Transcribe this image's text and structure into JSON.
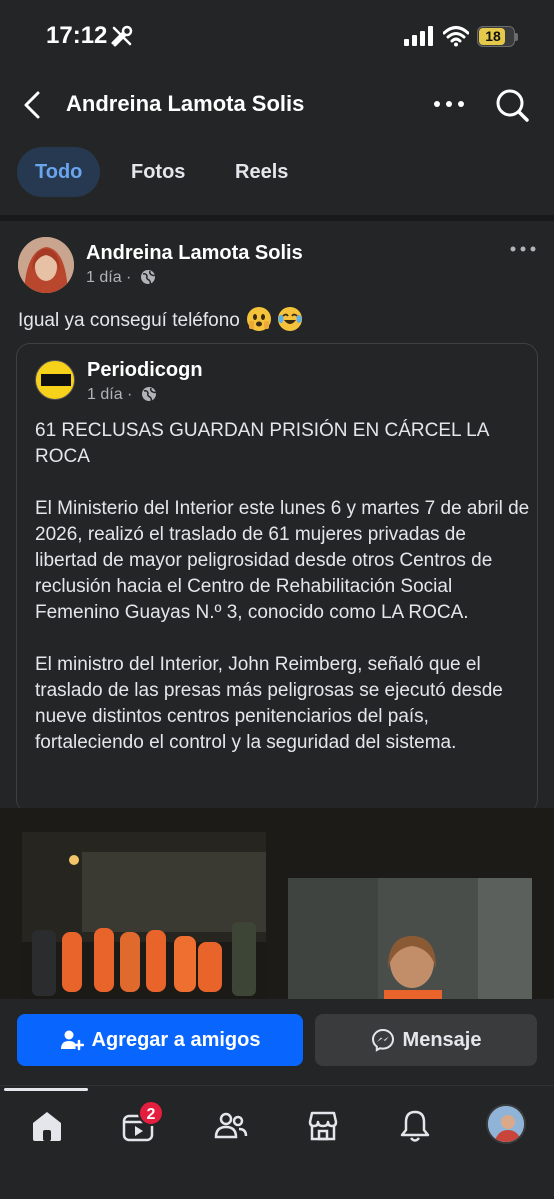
{
  "status_bar": {
    "time": "17:12",
    "battery_level": "18",
    "battery_color": "#e4c94b"
  },
  "header": {
    "title": "Andreina Lamota Solis",
    "back_icon": "chevron-left-icon",
    "more_icon": "more-horizontal-icon",
    "search_icon": "search-icon"
  },
  "tabs": [
    {
      "label": "Todo",
      "active": true
    },
    {
      "label": "Fotos",
      "active": false
    },
    {
      "label": "Reels",
      "active": false
    }
  ],
  "post": {
    "author": "Andreina Lamota Solis",
    "time": "1 día",
    "separator": "·",
    "privacy_icon": "globe-icon",
    "text": "Igual ya conseguí teléfono",
    "emojis": [
      "face-holding-back-tears-emoji",
      "tears-of-joy-emoji"
    ],
    "shared": {
      "page_name": "Periodicogn",
      "time": "1 día",
      "separator": "·",
      "headline": "61 RECLUSAS GUARDAN PRISIÓN EN CÁRCEL LA ROCA",
      "paragraph_1": "El Ministerio del Interior este lunes 6 y martes 7 de abril de 2026, realizó el traslado de 61 mujeres privadas de libertad de mayor peligrosidad desde otros Centros de reclusión hacia el Centro de Rehabilitación Social Femenino Guayas N.º 3, conocido como LA ROCA.",
      "paragraph_2": "El ministro del Interior, John Reimberg, señaló que el traslado de las presas más peligrosas se ejecutó desde nueve distintos centros penitenciarios del país, fortaleciendo el control y la seguridad del sistema."
    }
  },
  "actions": {
    "add_friend": "Agregar a amigos",
    "message": "Mensaje",
    "primary_color": "#0866ff"
  },
  "bottom_nav": {
    "items": [
      "home-icon",
      "video-icon",
      "friends-icon",
      "marketplace-icon",
      "bell-icon",
      "profile-avatar"
    ],
    "video_badge": "2"
  }
}
